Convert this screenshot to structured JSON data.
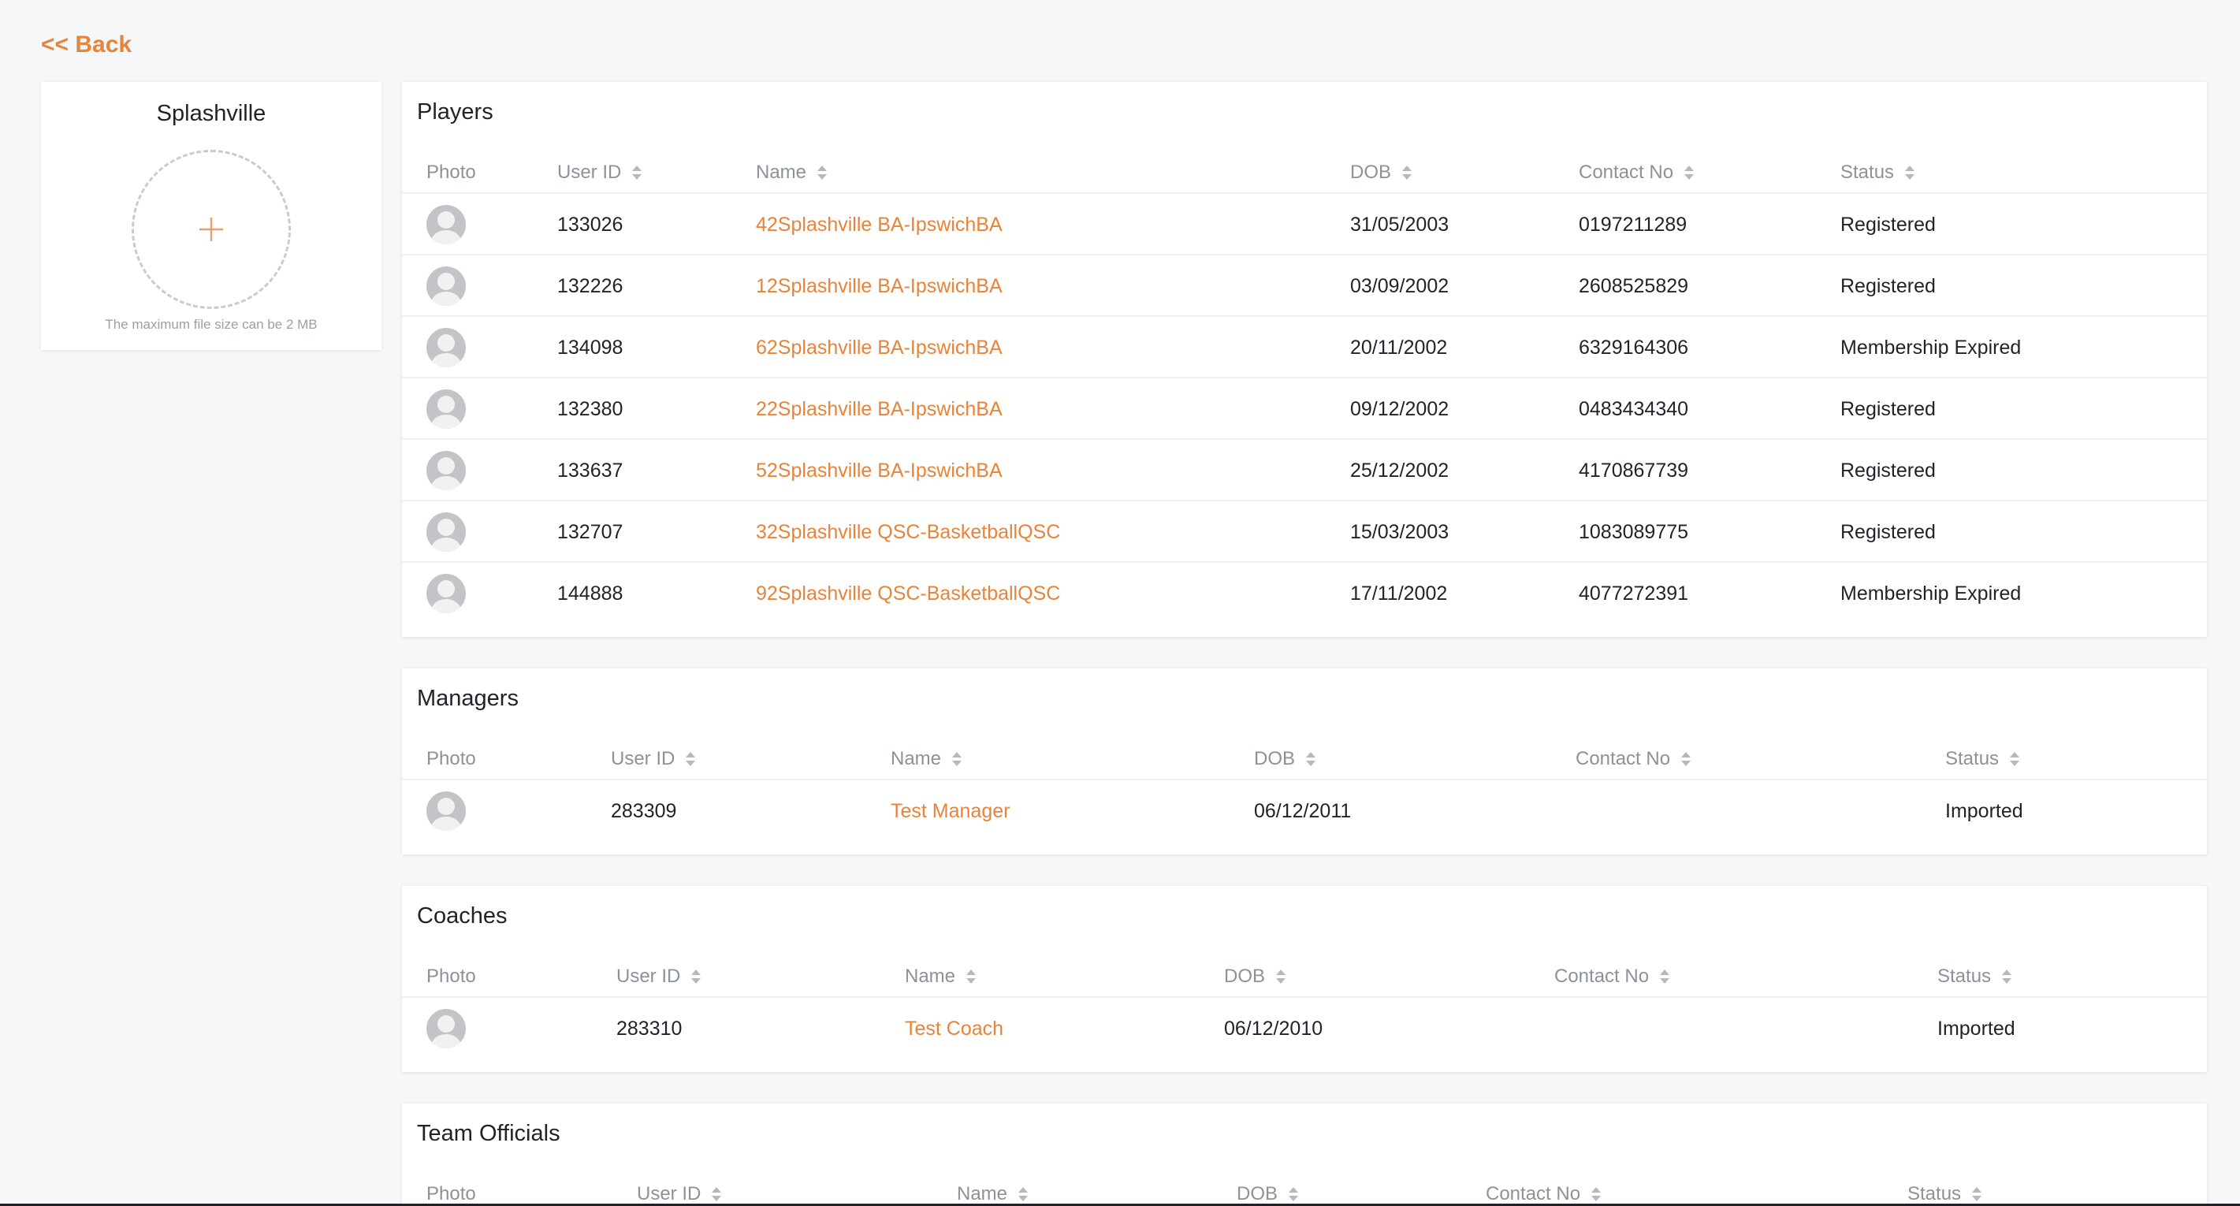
{
  "back_label": "<< Back",
  "team": {
    "name": "Splashville",
    "upload_hint": "The maximum file size can be 2 MB"
  },
  "accent_color": "#e8833a",
  "players": {
    "title": "Players",
    "columns": [
      "Photo",
      "User ID",
      "Name",
      "DOB",
      "Contact No",
      "Status"
    ],
    "rows": [
      {
        "user_id": "133026",
        "name": "42Splashville BA-IpswichBA",
        "dob": "31/05/2003",
        "contact": "0197211289",
        "status": "Registered"
      },
      {
        "user_id": "132226",
        "name": "12Splashville BA-IpswichBA",
        "dob": "03/09/2002",
        "contact": "2608525829",
        "status": "Registered"
      },
      {
        "user_id": "134098",
        "name": "62Splashville BA-IpswichBA",
        "dob": "20/11/2002",
        "contact": "6329164306",
        "status": "Membership Expired"
      },
      {
        "user_id": "132380",
        "name": "22Splashville BA-IpswichBA",
        "dob": "09/12/2002",
        "contact": "0483434340",
        "status": "Registered"
      },
      {
        "user_id": "133637",
        "name": "52Splashville BA-IpswichBA",
        "dob": "25/12/2002",
        "contact": "4170867739",
        "status": "Registered"
      },
      {
        "user_id": "132707",
        "name": "32Splashville QSC-BasketballQSC",
        "dob": "15/03/2003",
        "contact": "1083089775",
        "status": "Registered"
      },
      {
        "user_id": "144888",
        "name": "92Splashville QSC-BasketballQSC",
        "dob": "17/11/2002",
        "contact": "4077272391",
        "status": "Membership Expired"
      }
    ]
  },
  "managers": {
    "title": "Managers",
    "columns": [
      "Photo",
      "User ID",
      "Name",
      "DOB",
      "Contact No",
      "Status"
    ],
    "rows": [
      {
        "user_id": "283309",
        "name": "Test Manager",
        "dob": "06/12/2011",
        "contact": "",
        "status": "Imported"
      }
    ]
  },
  "coaches": {
    "title": "Coaches",
    "columns": [
      "Photo",
      "User ID",
      "Name",
      "DOB",
      "Contact No",
      "Status"
    ],
    "rows": [
      {
        "user_id": "283310",
        "name": "Test Coach",
        "dob": "06/12/2010",
        "contact": "",
        "status": "Imported"
      }
    ]
  },
  "team_officials": {
    "title": "Team Officials",
    "columns": [
      "Photo",
      "User ID",
      "Name",
      "DOB",
      "Contact No",
      "Status"
    ],
    "rows": []
  }
}
